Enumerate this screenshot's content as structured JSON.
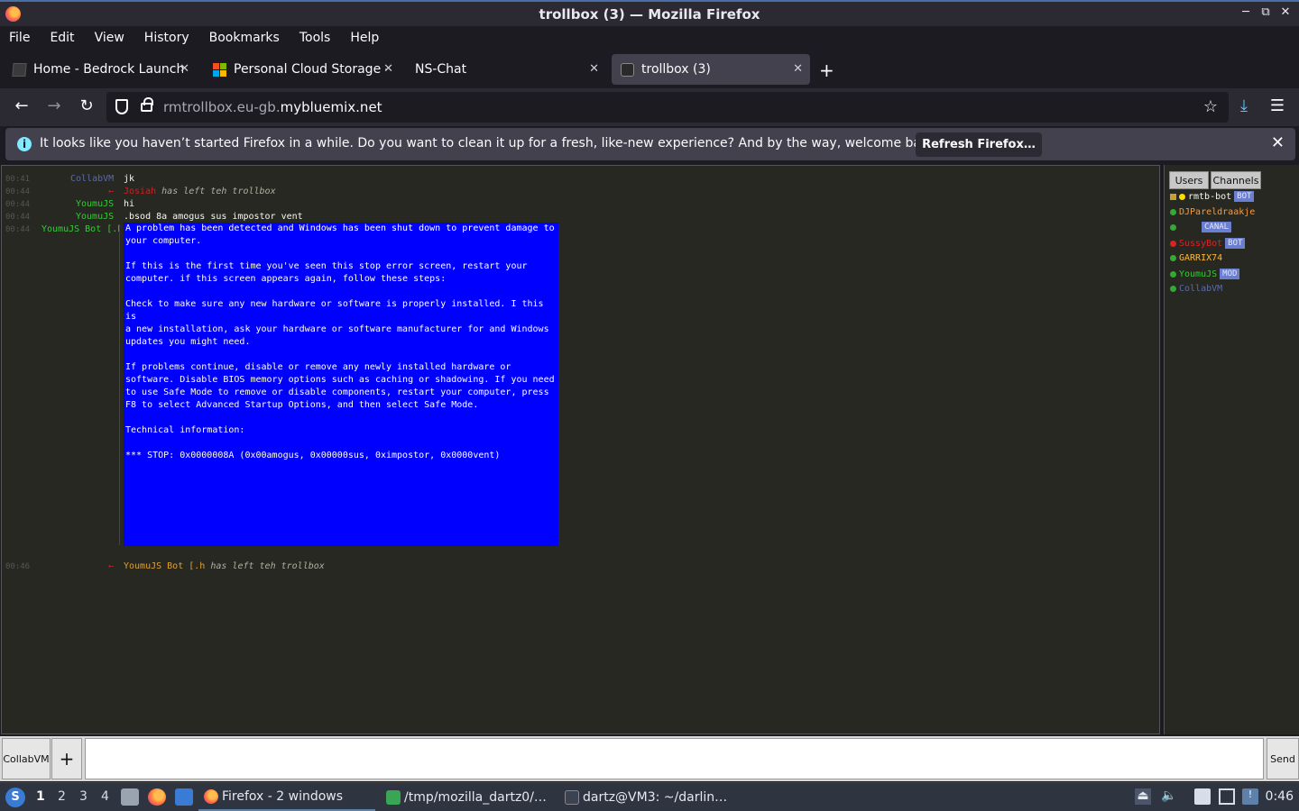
{
  "window": {
    "title": "trollbox (3) — Mozilla Firefox"
  },
  "menu": [
    "File",
    "Edit",
    "View",
    "History",
    "Bookmarks",
    "Tools",
    "Help"
  ],
  "tabs": [
    {
      "label": "Home - Bedrock Launche",
      "icon": "bedrock-cube-icon"
    },
    {
      "label": "Personal Cloud Storage -",
      "icon": "microsoft-logo-icon"
    },
    {
      "label": "NS-Chat",
      "icon": ""
    },
    {
      "label": "trollbox (3)",
      "icon": "trollbox-shield-icon"
    }
  ],
  "nav": {
    "url_prefix": "rmtrollbox.eu-gb.",
    "url_domain": "mybluemix.net"
  },
  "notification": {
    "text": "It looks like you haven’t started Firefox in a while. Do you want to clean it up for a fresh, like-new experience? And by the way, welcome back!",
    "button": "Refresh Firefox…"
  },
  "chat": {
    "messages": [
      {
        "time": "00:41",
        "nick": "CollabVM",
        "nick_color": "#5b6aa8",
        "text": "jk"
      },
      {
        "time": "00:44",
        "nick": "←",
        "nick_color": "#cc2222",
        "text_user": "Josiah",
        "text_user_color": "#cc2222",
        "text": "has left teh trollbox"
      },
      {
        "time": "00:44",
        "nick": "YoumuJS",
        "nick_color": "#33cc33",
        "text": "hi"
      },
      {
        "time": "00:44",
        "nick": "YoumuJS",
        "nick_color": "#33cc33",
        "text": ".bsod 8a amogus sus impostor vent"
      },
      {
        "time": "00:44",
        "nick": "YoumuJS Bot [.h",
        "nick_color": "#33cc33",
        "text": ""
      },
      {
        "time": "00:46",
        "nick": "←",
        "nick_color": "#cc2222",
        "text_user": "YoumuJS Bot [.h",
        "text_user_color": "#e0a030",
        "text": "has left teh trollbox"
      }
    ],
    "bsod": [
      "A problem has been detected and Windows has been shut down to prevent damage to\nyour computer.",
      "If this is the first time you've seen this stop error screen, restart your\ncomputer. if this screen appears again, follow these steps:",
      "Check to make sure any new hardware or software is properly installed. I this is\na new installation, ask your hardware or software manufacturer for and Windows\nupdates you might need.",
      "If problems continue, disable or remove any newly installed hardware or\nsoftware. Disable BIOS memory options such as caching or shadowing. If you need\nto use Safe Mode to remove or disable components, restart your computer, press\nF8 to select Advanced Startup Options, and then select Safe Mode.",
      "Technical information:",
      "*** STOP: 0x0000008A (0x00amogus, 0x00000sus, 0ximpostor, 0x0000vent)"
    ]
  },
  "sidebar": {
    "tabs": [
      "Users",
      "Channels"
    ],
    "users": [
      {
        "name": "rmtb-bot",
        "color": "#f8f8f2",
        "dot": "#ffdd00",
        "badge": "BOT",
        "lock": true
      },
      {
        "name": "DJPareldraakje",
        "color": "#ff9933",
        "dot": "#33aa33",
        "badge": ""
      },
      {
        "name": "",
        "color": "#2233cc",
        "dot": "#33aa33",
        "badge": "CANAL"
      },
      {
        "name": "SussyBot",
        "color": "#dd2222",
        "dot": "#dd2222",
        "badge": "BOT"
      },
      {
        "name": "GARRIX74",
        "color": "#ffbb33",
        "dot": "#33aa33",
        "badge": ""
      },
      {
        "name": "YoumuJS",
        "color": "#33cc33",
        "dot": "#33aa33",
        "badge": "MOD"
      },
      {
        "name": "CollabVM",
        "color": "#5b6aa8",
        "dot": "#33aa33",
        "badge": ""
      }
    ]
  },
  "input": {
    "channel": "CollabVM",
    "plus": "+",
    "send": "Send",
    "value": ""
  },
  "taskbar": {
    "workspaces": [
      "1",
      "2",
      "3",
      "4"
    ],
    "tasks": [
      {
        "label": "Firefox - 2 windows",
        "icon": "firefox-icon"
      },
      {
        "label": "/tmp/mozilla_dartz0/…",
        "icon": "file-archive-icon"
      },
      {
        "label": "dartz@VM3: ~/darlin…",
        "icon": "terminal-icon"
      }
    ],
    "clock": "0:46"
  }
}
